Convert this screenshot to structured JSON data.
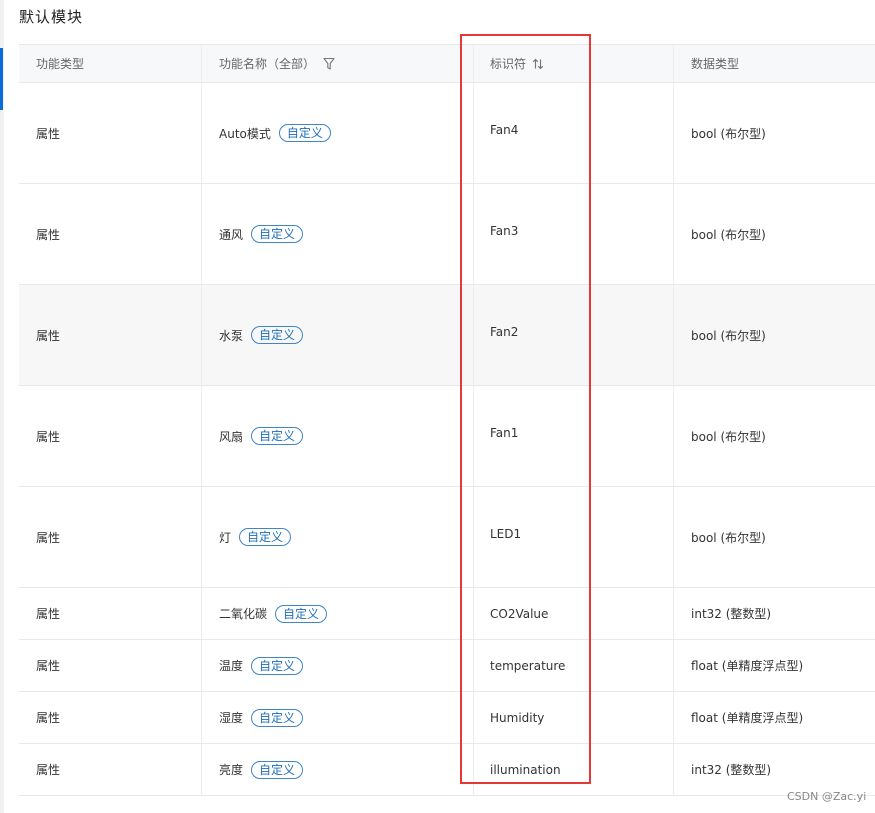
{
  "section": {
    "title": "默认模块"
  },
  "table": {
    "headers": {
      "type": "功能类型",
      "name": "功能名称（全部）",
      "identifier": "标识符",
      "data_type": "数据类型"
    },
    "rows": [
      {
        "type": "属性",
        "name": "Auto模式",
        "tag": "自定义",
        "identifier": "Fan4",
        "data_type": "bool (布尔型)"
      },
      {
        "type": "属性",
        "name": "通风",
        "tag": "自定义",
        "identifier": "Fan3",
        "data_type": "bool (布尔型)"
      },
      {
        "type": "属性",
        "name": "水泵",
        "tag": "自定义",
        "identifier": "Fan2",
        "data_type": "bool (布尔型)"
      },
      {
        "type": "属性",
        "name": "风扇",
        "tag": "自定义",
        "identifier": "Fan1",
        "data_type": "bool (布尔型)"
      },
      {
        "type": "属性",
        "name": "灯",
        "tag": "自定义",
        "identifier": "LED1",
        "data_type": "bool (布尔型)"
      },
      {
        "type": "属性",
        "name": "二氧化碳",
        "tag": "自定义",
        "identifier": "CO2Value",
        "data_type": "int32 (整数型)"
      },
      {
        "type": "属性",
        "name": "温度",
        "tag": "自定义",
        "identifier": "temperature",
        "data_type": "float (单精度浮点型)"
      },
      {
        "type": "属性",
        "name": "湿度",
        "tag": "自定义",
        "identifier": "Humidity",
        "data_type": "float (单精度浮点型)"
      },
      {
        "type": "属性",
        "name": "亮度",
        "tag": "自定义",
        "identifier": "illumination",
        "data_type": "int32 (整数型)"
      }
    ]
  },
  "icons": {
    "filter": "filter-icon",
    "sort": "sort-icon"
  },
  "colors": {
    "highlight": "#e53935",
    "tag": "#1e6fba",
    "accent": "#0a6cd6"
  },
  "watermark": "CSDN @Zac.yi"
}
